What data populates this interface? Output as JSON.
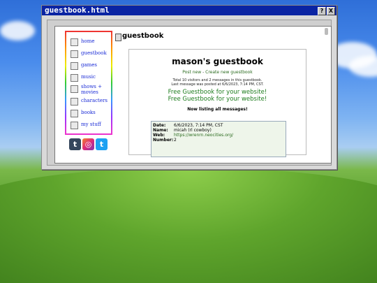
{
  "window": {
    "title": "guestbook.html",
    "help_label": "?",
    "close_label": "X"
  },
  "sidebar": {
    "items": [
      {
        "label": "home",
        "icon": "computer-icon"
      },
      {
        "label": "guestbook",
        "icon": "book-icon"
      },
      {
        "label": "games",
        "icon": "gamepad-icon"
      },
      {
        "label": "music",
        "icon": "music-icon"
      },
      {
        "label": "shows + movies",
        "icon": "film-icon"
      },
      {
        "label": "characters",
        "icon": "person-icon"
      },
      {
        "label": "books",
        "icon": "books-icon"
      },
      {
        "label": "my stuff",
        "icon": "pencil-icon"
      }
    ],
    "social": [
      {
        "label": "t",
        "icon": "tumblr-icon",
        "color": "#35465c"
      },
      {
        "label": "◎",
        "icon": "instagram-icon",
        "color": "#c13584"
      },
      {
        "label": "t",
        "icon": "twitter-icon",
        "color": "#1da1f2"
      }
    ]
  },
  "content": {
    "heading": "guestbook",
    "guestbook": {
      "title": "mason's guestbook",
      "post_new": "Post new",
      "separator": " - ",
      "create_new": "Create new guestbook",
      "stats_line1": "Total 10 visitors and 2 messages in this guestbook.",
      "stats_line2": "Last message was posted at 6/6/2023, 7:14 PM, CST.",
      "promo1": "Free Guestbook for your website!",
      "promo2": "Free Guestbook for your website!",
      "listing": "Now listing all messages!",
      "entry": {
        "date_label": "Date:",
        "date": "6/6/2023, 7:14 PM, CST",
        "name_label": "Name:",
        "name": "micah (rl cowboy)",
        "web_label": "Web:",
        "web": "https://wrenrn.neocities.org/",
        "number_label": "Number:",
        "number": "2"
      }
    }
  }
}
